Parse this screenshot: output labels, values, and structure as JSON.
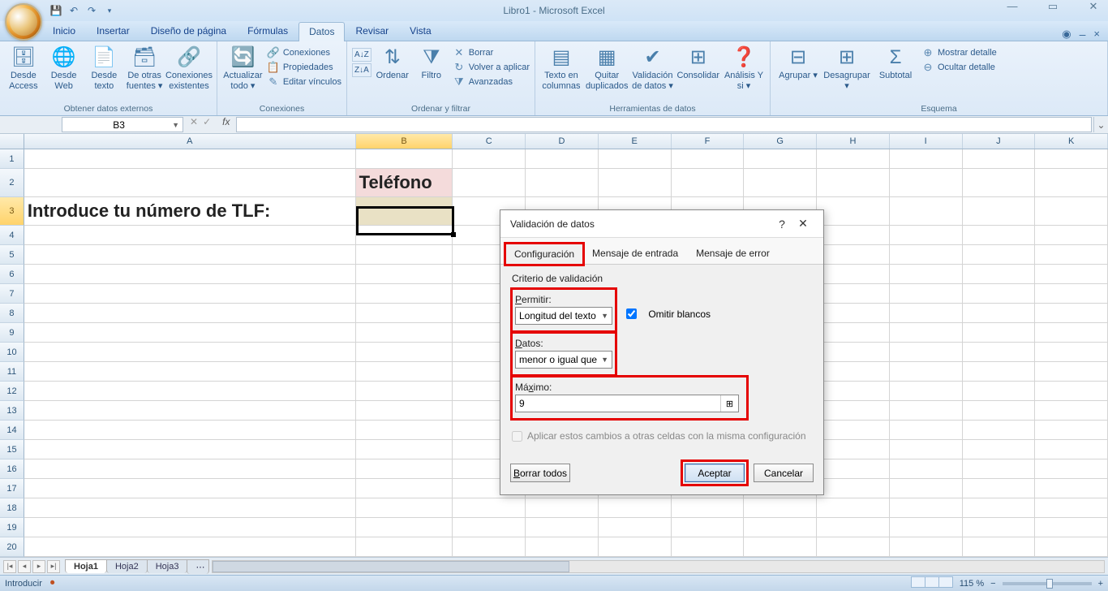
{
  "title": "Libro1 - Microsoft Excel",
  "tabs": {
    "inicio": "Inicio",
    "insertar": "Insertar",
    "diseno": "Diseño de página",
    "formulas": "Fórmulas",
    "datos": "Datos",
    "revisar": "Revisar",
    "vista": "Vista"
  },
  "ribbon": {
    "externos": {
      "title": "Obtener datos externos",
      "access": "Desde Access",
      "web": "Desde Web",
      "texto": "Desde texto",
      "otras": "De otras fuentes ▾",
      "existentes": "Conexiones existentes"
    },
    "conexiones": {
      "title": "Conexiones",
      "actualizar": "Actualizar todo ▾",
      "conex": "Conexiones",
      "prop": "Propiedades",
      "editar": "Editar vínculos"
    },
    "ordenar": {
      "title": "Ordenar y filtrar",
      "az_small": "A→Z",
      "za_small": "Z→A",
      "ordenar": "Ordenar",
      "filtro": "Filtro",
      "borrar": "Borrar",
      "volver": "Volver a aplicar",
      "avanz": "Avanzadas"
    },
    "herr": {
      "title": "Herramientas de datos",
      "textocol": "Texto en columnas",
      "quitar": "Quitar duplicados",
      "valid": "Validación de datos ▾",
      "consol": "Consolidar",
      "ysi": "Análisis Y si ▾"
    },
    "esquema": {
      "title": "Esquema",
      "agrupar": "Agrupar ▾",
      "desagrupar": "Desagrupar ▾",
      "subtotal": "Subtotal",
      "mostrar": "Mostrar detalle",
      "ocultar": "Ocultar detalle"
    }
  },
  "namebox": "B3",
  "cells": {
    "b2": "Teléfono",
    "a3": "Introduce tu número de TLF:"
  },
  "columns": [
    "A",
    "B",
    "C",
    "D",
    "E",
    "F",
    "G",
    "H",
    "I",
    "J",
    "K"
  ],
  "sheets": {
    "s1": "Hoja1",
    "s2": "Hoja2",
    "s3": "Hoja3"
  },
  "status": {
    "mode": "Introducir",
    "zoom": "115 %"
  },
  "dialog": {
    "title": "Validación de datos",
    "tab_config": "Configuración",
    "tab_entrada": "Mensaje de entrada",
    "tab_error": "Mensaje de error",
    "criterio": "Criterio de validación",
    "permitir_lbl": "Permitir:",
    "permitir_val": "Longitud del texto",
    "omitir": "Omitir blancos",
    "datos_lbl": "Datos:",
    "datos_val": "menor o igual que",
    "max_lbl": "Máximo:",
    "max_val": "9",
    "aplicar": "Aplicar estos cambios a otras celdas con la misma configuración",
    "borrar": "Borrar todos",
    "aceptar": "Aceptar",
    "cancelar": "Cancelar"
  }
}
